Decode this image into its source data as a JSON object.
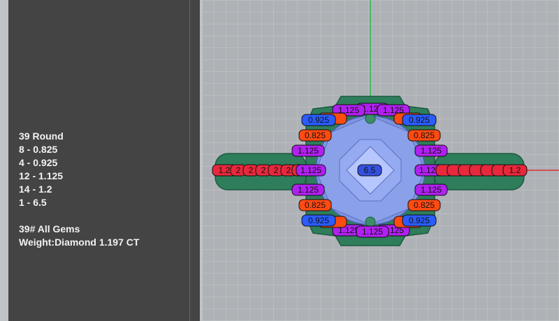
{
  "summary": {
    "gem_type": "39 Round",
    "lines": [
      "8 - 0.825",
      "4 - 0.925",
      "12 - 1.125",
      "14 - 1.2",
      "1 - 6.5"
    ],
    "all_gems": "39# All Gems",
    "weight": "Weight:Diamond 1.197 CT"
  },
  "colors": {
    "viewport_bg": "#aeb2b6",
    "grid": "#c4c8cb",
    "panel_bg": "#444444",
    "metal": "#2e7d5b",
    "gem": "#8aa0e8",
    "axis_x": "#e03030",
    "axis_y": "#22c04a",
    "tag_0825": "#ff4a12",
    "tag_0925": "#2a5cff",
    "tag_1125": "#b020f0",
    "tag_12": "#e8283c",
    "tag_65": "#3450e0"
  },
  "tags": {
    "s0825": "0.825",
    "s0925": "0.925",
    "s1125": "1.125",
    "s12": "1.2",
    "s12_frag": "2",
    "s65": "6.5"
  }
}
